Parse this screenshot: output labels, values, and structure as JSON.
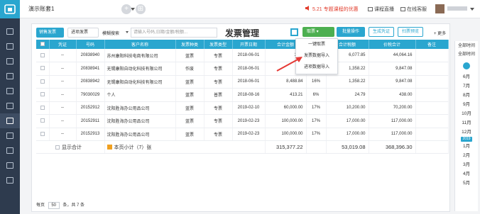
{
  "topbar": {
    "account_name": "演示账套1",
    "add_btn": "+",
    "apps_btn": "⊞",
    "promo": "5.21 专题课程的优惠",
    "course_live": "课程直播",
    "online_service": "在线客服"
  },
  "panel": {
    "tab_sales": "销售发票",
    "tab_purchase": "进项发票",
    "search_mode": "模糊搜索",
    "search_placeholder": "请输入号码,日期/金额/税额...",
    "title": "发票管理",
    "btn_fetch": "取票",
    "btn_batch": "批量操作",
    "btn_voucher": "生成凭证",
    "btn_scan": "扫票预览",
    "btn_more": "+ 更多"
  },
  "columns": [
    "",
    "凭证",
    "号码",
    "客户名称",
    "发票种类",
    "发票类型",
    "开票日期",
    "合计金额",
    "税率",
    "合计税额",
    "价税合计",
    "备注"
  ],
  "rows": [
    {
      "voucher": "--",
      "number": "20838940",
      "customer": "苏州康阳科技电商有限公司",
      "kind": "蓝票",
      "type": "专票",
      "date": "2018-06-01",
      "amount": "37...",
      "rate": "16%",
      "tax": "6,077.85",
      "total": "44,064.16"
    },
    {
      "voucher": "--",
      "number": "20838941",
      "customer": "无锡康阳自动化科技有限公司",
      "kind": "作废",
      "type": "专票",
      "date": "2018-06-01",
      "amount": "8,...",
      "rate": "16%",
      "tax": "1,358.22",
      "total": "9,847.08"
    },
    {
      "voucher": "--",
      "number": "20838942",
      "customer": "无锡康阳自动化科技有限公司",
      "kind": "蓝票",
      "type": "专票",
      "date": "2018-06-01",
      "amount": "8,488.84",
      "rate": "16%",
      "tax": "1,358.22",
      "total": "9,847.08"
    },
    {
      "voucher": "--",
      "number": "79030029",
      "customer": "个人",
      "kind": "蓝票",
      "type": "普票",
      "date": "2018-08-16",
      "amount": "413.21",
      "rate": "6%",
      "tax": "24.79",
      "total": "438.00"
    },
    {
      "voucher": "--",
      "number": "20152912",
      "customer": "沈阳胜海办公用品公司",
      "kind": "蓝票",
      "type": "专票",
      "date": "2019-02-10",
      "amount": "60,000.00",
      "rate": "17%",
      "tax": "10,200.00",
      "total": "70,200.00"
    },
    {
      "voucher": "--",
      "number": "20152911",
      "customer": "沈阳胜海办公用品公司",
      "kind": "蓝票",
      "type": "专票",
      "date": "2019-02-23",
      "amount": "100,000.00",
      "rate": "17%",
      "tax": "17,000.00",
      "total": "117,000.00"
    },
    {
      "voucher": "--",
      "number": "20152913",
      "customer": "沈阳胜海办公用品公司",
      "kind": "蓝票",
      "type": "专票",
      "date": "2019-02-23",
      "amount": "100,000.00",
      "rate": "17%",
      "tax": "17,000.00",
      "total": "117,000.00"
    }
  ],
  "totals": {
    "show_total_label": "显示合计",
    "page_subtotal": "本页小计（7）张",
    "amount": "315,377.22",
    "tax": "53,019.08",
    "total": "368,396.30"
  },
  "pager": {
    "per_page_label": "每页",
    "per_page": "50",
    "summary": "条，共 7 条"
  },
  "dropdown": [
    "一键取票",
    "发票数据导入",
    "进项数据导入"
  ],
  "date_panel": {
    "all_time_1": "全部时间",
    "all_time_2": "全部时间",
    "months_top": [
      "6月",
      "7月",
      "8月",
      "9月",
      "10月",
      "11月",
      "12月"
    ],
    "year_badge": "2019",
    "months_bottom": [
      "1月",
      "2月",
      "3月",
      "4月",
      "5月"
    ]
  },
  "colors": {
    "accent": "#2aa6cf",
    "green": "#4caf50",
    "sidebar": "#2e3b4e",
    "arrow": "#e53935"
  }
}
